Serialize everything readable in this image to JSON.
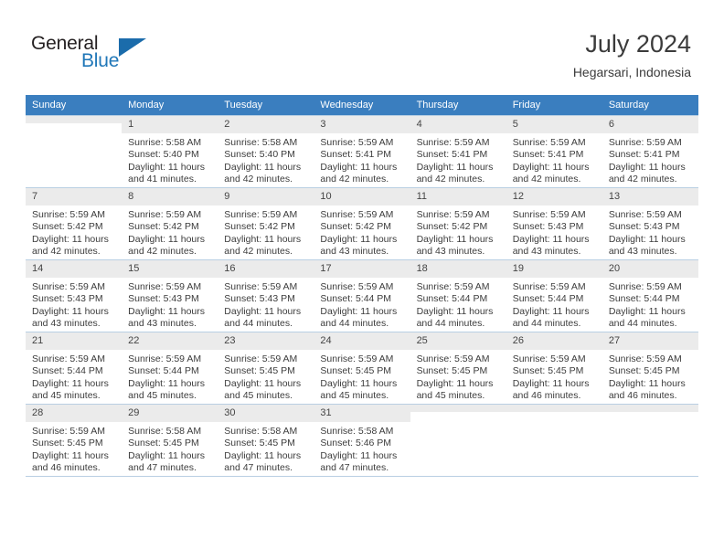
{
  "brand": {
    "line1": "General",
    "line2": "Blue",
    "triangle_icon": "brand-triangle-icon",
    "color_dark": "#231f20",
    "color_blue": "#2077b8"
  },
  "header": {
    "title": "July 2024",
    "subtitle": "Hegarsari, Indonesia"
  },
  "calendar": {
    "header_bg": "#3a7ebf",
    "weekdays": [
      "Sunday",
      "Monday",
      "Tuesday",
      "Wednesday",
      "Thursday",
      "Friday",
      "Saturday"
    ],
    "weeks": [
      [
        {
          "day": "",
          "sunrise": "",
          "sunset": "",
          "daylight1": "",
          "daylight2": ""
        },
        {
          "day": "1",
          "sunrise": "Sunrise: 5:58 AM",
          "sunset": "Sunset: 5:40 PM",
          "daylight1": "Daylight: 11 hours",
          "daylight2": "and 41 minutes."
        },
        {
          "day": "2",
          "sunrise": "Sunrise: 5:58 AM",
          "sunset": "Sunset: 5:40 PM",
          "daylight1": "Daylight: 11 hours",
          "daylight2": "and 42 minutes."
        },
        {
          "day": "3",
          "sunrise": "Sunrise: 5:59 AM",
          "sunset": "Sunset: 5:41 PM",
          "daylight1": "Daylight: 11 hours",
          "daylight2": "and 42 minutes."
        },
        {
          "day": "4",
          "sunrise": "Sunrise: 5:59 AM",
          "sunset": "Sunset: 5:41 PM",
          "daylight1": "Daylight: 11 hours",
          "daylight2": "and 42 minutes."
        },
        {
          "day": "5",
          "sunrise": "Sunrise: 5:59 AM",
          "sunset": "Sunset: 5:41 PM",
          "daylight1": "Daylight: 11 hours",
          "daylight2": "and 42 minutes."
        },
        {
          "day": "6",
          "sunrise": "Sunrise: 5:59 AM",
          "sunset": "Sunset: 5:41 PM",
          "daylight1": "Daylight: 11 hours",
          "daylight2": "and 42 minutes."
        }
      ],
      [
        {
          "day": "7",
          "sunrise": "Sunrise: 5:59 AM",
          "sunset": "Sunset: 5:42 PM",
          "daylight1": "Daylight: 11 hours",
          "daylight2": "and 42 minutes."
        },
        {
          "day": "8",
          "sunrise": "Sunrise: 5:59 AM",
          "sunset": "Sunset: 5:42 PM",
          "daylight1": "Daylight: 11 hours",
          "daylight2": "and 42 minutes."
        },
        {
          "day": "9",
          "sunrise": "Sunrise: 5:59 AM",
          "sunset": "Sunset: 5:42 PM",
          "daylight1": "Daylight: 11 hours",
          "daylight2": "and 42 minutes."
        },
        {
          "day": "10",
          "sunrise": "Sunrise: 5:59 AM",
          "sunset": "Sunset: 5:42 PM",
          "daylight1": "Daylight: 11 hours",
          "daylight2": "and 43 minutes."
        },
        {
          "day": "11",
          "sunrise": "Sunrise: 5:59 AM",
          "sunset": "Sunset: 5:42 PM",
          "daylight1": "Daylight: 11 hours",
          "daylight2": "and 43 minutes."
        },
        {
          "day": "12",
          "sunrise": "Sunrise: 5:59 AM",
          "sunset": "Sunset: 5:43 PM",
          "daylight1": "Daylight: 11 hours",
          "daylight2": "and 43 minutes."
        },
        {
          "day": "13",
          "sunrise": "Sunrise: 5:59 AM",
          "sunset": "Sunset: 5:43 PM",
          "daylight1": "Daylight: 11 hours",
          "daylight2": "and 43 minutes."
        }
      ],
      [
        {
          "day": "14",
          "sunrise": "Sunrise: 5:59 AM",
          "sunset": "Sunset: 5:43 PM",
          "daylight1": "Daylight: 11 hours",
          "daylight2": "and 43 minutes."
        },
        {
          "day": "15",
          "sunrise": "Sunrise: 5:59 AM",
          "sunset": "Sunset: 5:43 PM",
          "daylight1": "Daylight: 11 hours",
          "daylight2": "and 43 minutes."
        },
        {
          "day": "16",
          "sunrise": "Sunrise: 5:59 AM",
          "sunset": "Sunset: 5:43 PM",
          "daylight1": "Daylight: 11 hours",
          "daylight2": "and 44 minutes."
        },
        {
          "day": "17",
          "sunrise": "Sunrise: 5:59 AM",
          "sunset": "Sunset: 5:44 PM",
          "daylight1": "Daylight: 11 hours",
          "daylight2": "and 44 minutes."
        },
        {
          "day": "18",
          "sunrise": "Sunrise: 5:59 AM",
          "sunset": "Sunset: 5:44 PM",
          "daylight1": "Daylight: 11 hours",
          "daylight2": "and 44 minutes."
        },
        {
          "day": "19",
          "sunrise": "Sunrise: 5:59 AM",
          "sunset": "Sunset: 5:44 PM",
          "daylight1": "Daylight: 11 hours",
          "daylight2": "and 44 minutes."
        },
        {
          "day": "20",
          "sunrise": "Sunrise: 5:59 AM",
          "sunset": "Sunset: 5:44 PM",
          "daylight1": "Daylight: 11 hours",
          "daylight2": "and 44 minutes."
        }
      ],
      [
        {
          "day": "21",
          "sunrise": "Sunrise: 5:59 AM",
          "sunset": "Sunset: 5:44 PM",
          "daylight1": "Daylight: 11 hours",
          "daylight2": "and 45 minutes."
        },
        {
          "day": "22",
          "sunrise": "Sunrise: 5:59 AM",
          "sunset": "Sunset: 5:44 PM",
          "daylight1": "Daylight: 11 hours",
          "daylight2": "and 45 minutes."
        },
        {
          "day": "23",
          "sunrise": "Sunrise: 5:59 AM",
          "sunset": "Sunset: 5:45 PM",
          "daylight1": "Daylight: 11 hours",
          "daylight2": "and 45 minutes."
        },
        {
          "day": "24",
          "sunrise": "Sunrise: 5:59 AM",
          "sunset": "Sunset: 5:45 PM",
          "daylight1": "Daylight: 11 hours",
          "daylight2": "and 45 minutes."
        },
        {
          "day": "25",
          "sunrise": "Sunrise: 5:59 AM",
          "sunset": "Sunset: 5:45 PM",
          "daylight1": "Daylight: 11 hours",
          "daylight2": "and 45 minutes."
        },
        {
          "day": "26",
          "sunrise": "Sunrise: 5:59 AM",
          "sunset": "Sunset: 5:45 PM",
          "daylight1": "Daylight: 11 hours",
          "daylight2": "and 46 minutes."
        },
        {
          "day": "27",
          "sunrise": "Sunrise: 5:59 AM",
          "sunset": "Sunset: 5:45 PM",
          "daylight1": "Daylight: 11 hours",
          "daylight2": "and 46 minutes."
        }
      ],
      [
        {
          "day": "28",
          "sunrise": "Sunrise: 5:59 AM",
          "sunset": "Sunset: 5:45 PM",
          "daylight1": "Daylight: 11 hours",
          "daylight2": "and 46 minutes."
        },
        {
          "day": "29",
          "sunrise": "Sunrise: 5:58 AM",
          "sunset": "Sunset: 5:45 PM",
          "daylight1": "Daylight: 11 hours",
          "daylight2": "and 47 minutes."
        },
        {
          "day": "30",
          "sunrise": "Sunrise: 5:58 AM",
          "sunset": "Sunset: 5:45 PM",
          "daylight1": "Daylight: 11 hours",
          "daylight2": "and 47 minutes."
        },
        {
          "day": "31",
          "sunrise": "Sunrise: 5:58 AM",
          "sunset": "Sunset: 5:46 PM",
          "daylight1": "Daylight: 11 hours",
          "daylight2": "and 47 minutes."
        },
        {
          "day": "",
          "sunrise": "",
          "sunset": "",
          "daylight1": "",
          "daylight2": ""
        },
        {
          "day": "",
          "sunrise": "",
          "sunset": "",
          "daylight1": "",
          "daylight2": ""
        },
        {
          "day": "",
          "sunrise": "",
          "sunset": "",
          "daylight1": "",
          "daylight2": ""
        }
      ]
    ]
  }
}
